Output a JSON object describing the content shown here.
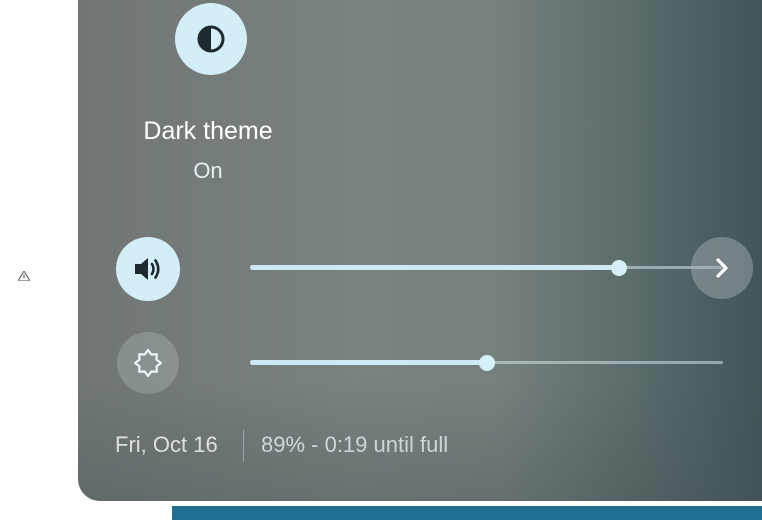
{
  "dark_theme": {
    "icon": "contrast-icon",
    "label": "Dark theme",
    "status": "On"
  },
  "volume": {
    "icon": "speaker-icon",
    "level_percent": 78,
    "detail_icon": "chevron-right-icon"
  },
  "brightness": {
    "icon": "brightness-icon",
    "level_percent": 50
  },
  "status": {
    "date": "Fri, Oct 16",
    "battery": "89% - 0:19 until full"
  },
  "colors": {
    "accent": "#d3eef7",
    "taskbar": "#1f6f93"
  }
}
